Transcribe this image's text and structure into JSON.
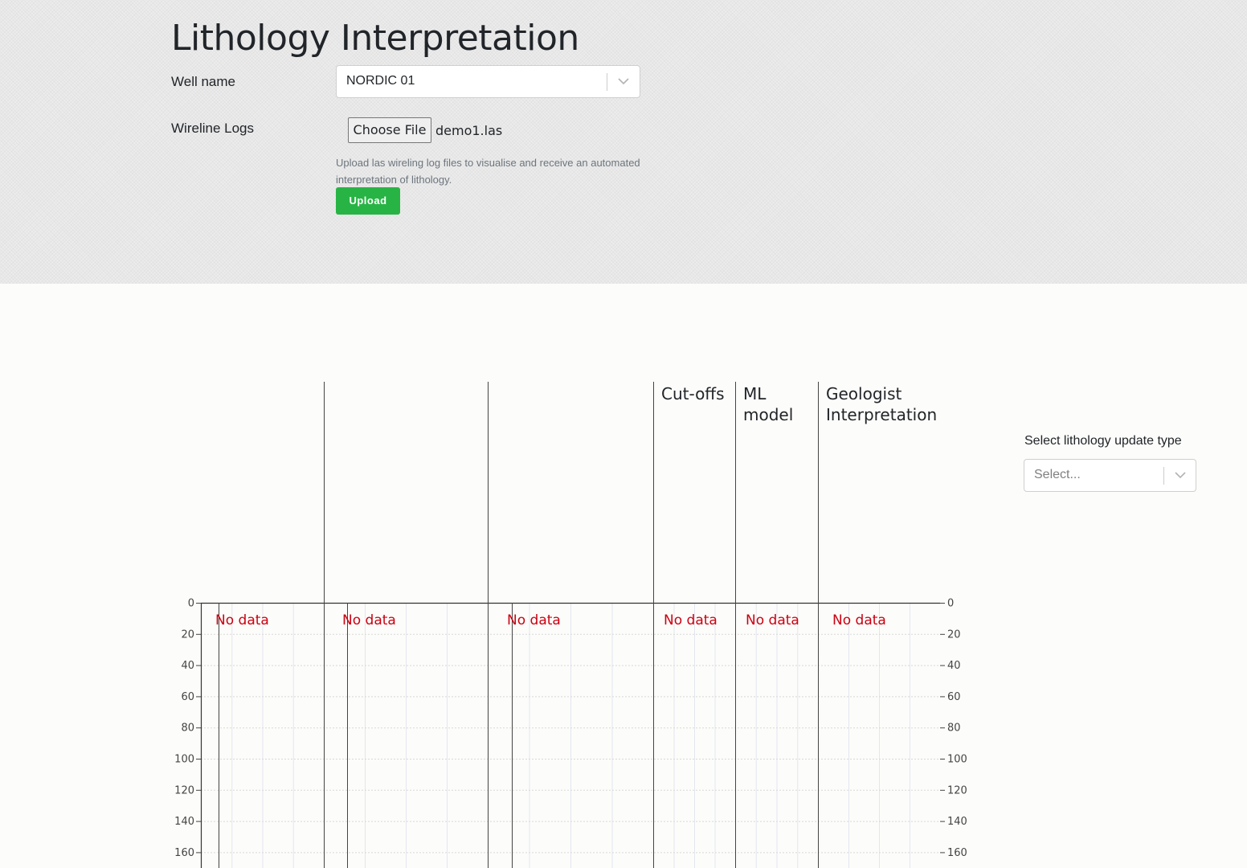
{
  "page": {
    "title": "Lithology Interpretation"
  },
  "form": {
    "well_label": "Well name",
    "well_value": "NORDIC 01",
    "logs_label": "Wireline Logs",
    "choose_file_label": "Choose File",
    "file_name": "demo1.las",
    "help_text": "Upload las wireling log files to visualise and receive an automated interpretation of lithology.",
    "upload_label": "Upload"
  },
  "side": {
    "update_label": "Select lithology update type",
    "update_placeholder": "Select..."
  },
  "chart_data": {
    "type": "line",
    "tracks": [
      {
        "title": "",
        "no_data": "No data"
      },
      {
        "title": "",
        "no_data": "No data"
      },
      {
        "title": "",
        "no_data": "No data"
      },
      {
        "title_lines": [
          "Cut-offs"
        ],
        "no_data": "No data"
      },
      {
        "title_lines": [
          "ML",
          "model"
        ],
        "no_data": "No data"
      },
      {
        "title_lines": [
          "Geologist",
          "Interpretation"
        ],
        "no_data": "No data"
      }
    ],
    "depth_ticks": [
      0,
      20,
      40,
      60,
      80,
      100,
      120,
      140,
      160
    ],
    "y_axis_reversed": true,
    "grid": true
  }
}
